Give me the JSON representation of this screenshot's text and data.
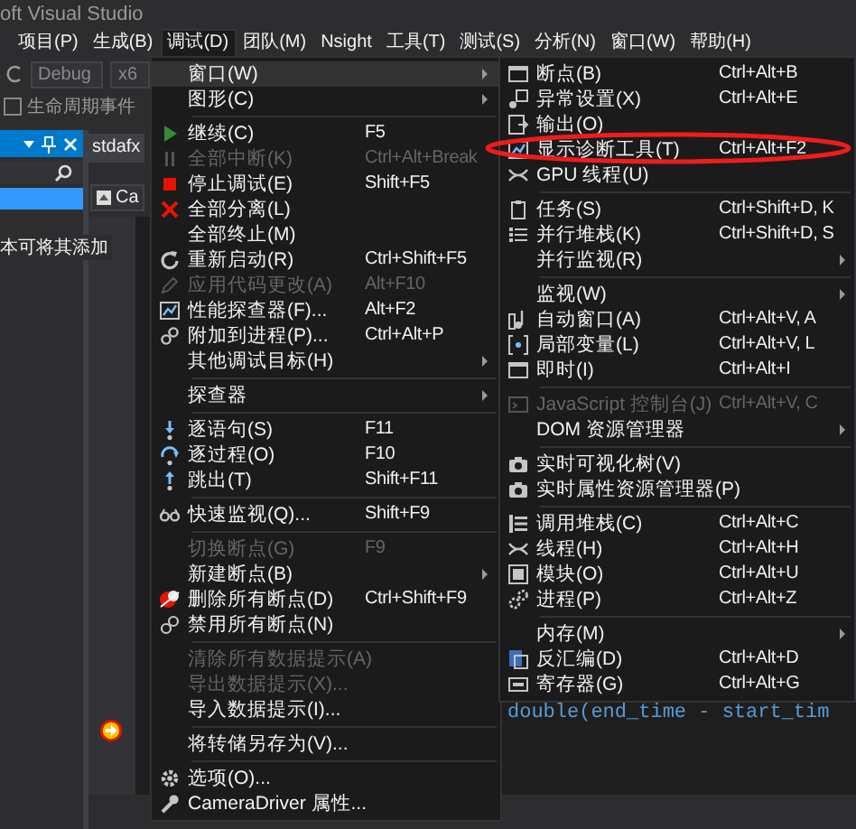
{
  "window": {
    "title": "oft Visual Studio"
  },
  "menu_bar": [
    {
      "label": "项目(P)",
      "selected": false
    },
    {
      "label": "生成(B)",
      "selected": false
    },
    {
      "label": "调试(D)",
      "selected": true
    },
    {
      "label": "团队(M)",
      "selected": false
    },
    {
      "label": "Nsight",
      "selected": false
    },
    {
      "label": "工具(T)",
      "selected": false
    },
    {
      "label": "测试(S)",
      "selected": false
    },
    {
      "label": "分析(N)",
      "selected": false
    },
    {
      "label": "窗口(W)",
      "selected": false
    },
    {
      "label": "帮助(H)",
      "selected": false
    }
  ],
  "toolbar": {
    "configuration": "Debug",
    "platform": "x6",
    "events": "生命周期事件"
  },
  "tool_window": {
    "text": "本可将其添加"
  },
  "editor": {
    "tab": "stdafx",
    "navigation": "Ca",
    "code_line": "double(end_time - start_tim"
  },
  "debug_menu": [
    {
      "kind": "item",
      "label": "窗口(W)",
      "submenu": true,
      "selected": true,
      "disabled": false
    },
    {
      "kind": "item",
      "label": "图形(C)",
      "submenu": true,
      "selected": false,
      "disabled": false
    },
    {
      "kind": "separator"
    },
    {
      "kind": "item",
      "label": "继续(C)",
      "shortcut": "F5",
      "selected": false,
      "disabled": false
    },
    {
      "kind": "item",
      "label": "全部中断(K)",
      "shortcut": "Ctrl+Alt+Break",
      "selected": false,
      "disabled": true
    },
    {
      "kind": "item",
      "label": "停止调试(E)",
      "shortcut": "Shift+F5",
      "selected": false,
      "disabled": false
    },
    {
      "kind": "item",
      "label": "全部分离(L)",
      "selected": false,
      "disabled": false
    },
    {
      "kind": "item",
      "label": "全部终止(M)",
      "selected": false,
      "disabled": false
    },
    {
      "kind": "item",
      "label": "重新启动(R)",
      "shortcut": "Ctrl+Shift+F5",
      "selected": false,
      "disabled": false
    },
    {
      "kind": "item",
      "label": "应用代码更改(A)",
      "shortcut": "Alt+F10",
      "selected": false,
      "disabled": true
    },
    {
      "kind": "item",
      "label": "性能探查器(F)...",
      "shortcut": "Alt+F2",
      "selected": false,
      "disabled": false
    },
    {
      "kind": "item",
      "label": "附加到进程(P)...",
      "shortcut": "Ctrl+Alt+P",
      "selected": false,
      "disabled": false
    },
    {
      "kind": "item",
      "label": "其他调试目标(H)",
      "submenu": true,
      "selected": false,
      "disabled": false
    },
    {
      "kind": "separator"
    },
    {
      "kind": "item",
      "label": "探查器",
      "submenu": true,
      "selected": false,
      "disabled": false
    },
    {
      "kind": "separator"
    },
    {
      "kind": "item",
      "label": "逐语句(S)",
      "shortcut": "F11",
      "selected": false,
      "disabled": false
    },
    {
      "kind": "item",
      "label": "逐过程(O)",
      "shortcut": "F10",
      "selected": false,
      "disabled": false
    },
    {
      "kind": "item",
      "label": "跳出(T)",
      "shortcut": "Shift+F11",
      "selected": false,
      "disabled": false
    },
    {
      "kind": "separator"
    },
    {
      "kind": "item",
      "label": "快速监视(Q)...",
      "shortcut": "Shift+F9",
      "selected": false,
      "disabled": false
    },
    {
      "kind": "separator"
    },
    {
      "kind": "item",
      "label": "切换断点(G)",
      "shortcut": "F9",
      "selected": false,
      "disabled": true
    },
    {
      "kind": "item",
      "label": "新建断点(B)",
      "submenu": true,
      "selected": false,
      "disabled": false
    },
    {
      "kind": "item",
      "label": "删除所有断点(D)",
      "shortcut": "Ctrl+Shift+F9",
      "selected": false,
      "disabled": false
    },
    {
      "kind": "item",
      "label": "禁用所有断点(N)",
      "selected": false,
      "disabled": false
    },
    {
      "kind": "separator"
    },
    {
      "kind": "item",
      "label": "清除所有数据提示(A)",
      "selected": false,
      "disabled": true
    },
    {
      "kind": "item",
      "label": "导出数据提示(X)...",
      "selected": false,
      "disabled": true
    },
    {
      "kind": "item",
      "label": "导入数据提示(I)...",
      "selected": false,
      "disabled": false
    },
    {
      "kind": "separator"
    },
    {
      "kind": "item",
      "label": "将转储另存为(V)...",
      "selected": false,
      "disabled": false
    },
    {
      "kind": "separator"
    },
    {
      "kind": "item",
      "label": "选项(O)...",
      "selected": false,
      "disabled": false
    },
    {
      "kind": "item",
      "label": "CameraDriver 属性...",
      "selected": false,
      "disabled": false
    }
  ],
  "window_submenu": [
    {
      "kind": "item",
      "label": "断点(B)",
      "shortcut": "Ctrl+Alt+B",
      "selected": false,
      "disabled": false
    },
    {
      "kind": "item",
      "label": "异常设置(X)",
      "shortcut": "Ctrl+Alt+E",
      "selected": false,
      "disabled": false
    },
    {
      "kind": "item",
      "label": "输出(O)",
      "selected": false,
      "disabled": false
    },
    {
      "kind": "item",
      "label": "显示诊断工具(T)",
      "shortcut": "Ctrl+Alt+F2",
      "selected": false,
      "disabled": false
    },
    {
      "kind": "item",
      "label": "GPU 线程(U)",
      "selected": false,
      "disabled": false
    },
    {
      "kind": "separator"
    },
    {
      "kind": "item",
      "label": "任务(S)",
      "shortcut": "Ctrl+Shift+D, K",
      "selected": false,
      "disabled": false
    },
    {
      "kind": "item",
      "label": "并行堆栈(K)",
      "shortcut": "Ctrl+Shift+D, S",
      "selected": false,
      "disabled": false
    },
    {
      "kind": "item",
      "label": "并行监视(R)",
      "submenu": true,
      "selected": false,
      "disabled": false
    },
    {
      "kind": "separator"
    },
    {
      "kind": "item",
      "label": "监视(W)",
      "submenu": true,
      "selected": false,
      "disabled": false
    },
    {
      "kind": "item",
      "label": "自动窗口(A)",
      "shortcut": "Ctrl+Alt+V, A",
      "selected": false,
      "disabled": false
    },
    {
      "kind": "item",
      "label": "局部变量(L)",
      "shortcut": "Ctrl+Alt+V, L",
      "selected": false,
      "disabled": false
    },
    {
      "kind": "item",
      "label": "即时(I)",
      "shortcut": "Ctrl+Alt+I",
      "selected": false,
      "disabled": false
    },
    {
      "kind": "separator"
    },
    {
      "kind": "item",
      "label": "JavaScript 控制台(J)",
      "shortcut": "Ctrl+Alt+V, C",
      "selected": false,
      "disabled": true
    },
    {
      "kind": "item",
      "label": "DOM 资源管理器",
      "submenu": true,
      "selected": false,
      "disabled": false
    },
    {
      "kind": "separator"
    },
    {
      "kind": "item",
      "label": "实时可视化树(V)",
      "selected": false,
      "disabled": false
    },
    {
      "kind": "item",
      "label": "实时属性资源管理器(P)",
      "selected": false,
      "disabled": false
    },
    {
      "kind": "separator"
    },
    {
      "kind": "item",
      "label": "调用堆栈(C)",
      "shortcut": "Ctrl+Alt+C",
      "selected": false,
      "disabled": false
    },
    {
      "kind": "item",
      "label": "线程(H)",
      "shortcut": "Ctrl+Alt+H",
      "selected": false,
      "disabled": false
    },
    {
      "kind": "item",
      "label": "模块(O)",
      "shortcut": "Ctrl+Alt+U",
      "selected": false,
      "disabled": false
    },
    {
      "kind": "item",
      "label": "进程(P)",
      "shortcut": "Ctrl+Alt+Z",
      "selected": false,
      "disabled": false
    },
    {
      "kind": "separator"
    },
    {
      "kind": "item",
      "label": "内存(M)",
      "submenu": true,
      "selected": false,
      "disabled": false
    },
    {
      "kind": "item",
      "label": "反汇编(D)",
      "shortcut": "Ctrl+Alt+D",
      "selected": false,
      "disabled": false
    },
    {
      "kind": "item",
      "label": "寄存器(G)",
      "shortcut": "Ctrl+Alt+G",
      "selected": false,
      "disabled": false
    }
  ],
  "annotation": {
    "kind": "ellipse"
  }
}
